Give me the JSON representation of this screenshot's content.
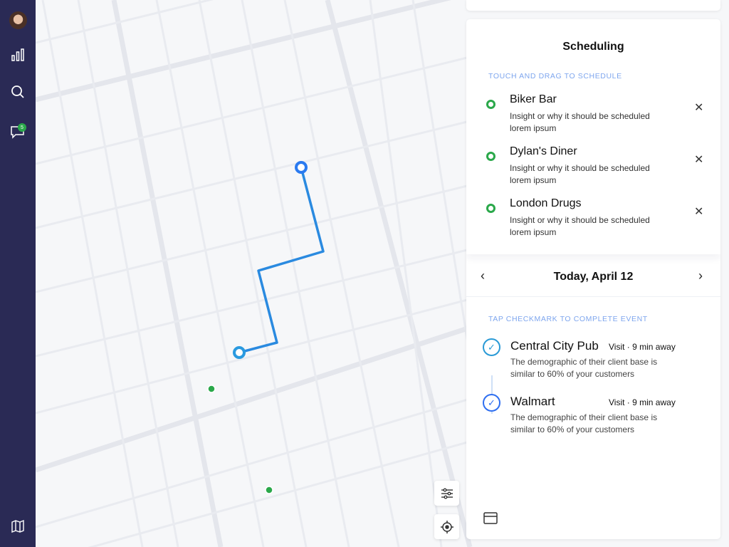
{
  "sidebar": {
    "items": [
      {
        "icon": "avatar"
      },
      {
        "icon": "bar-chart-icon"
      },
      {
        "icon": "search-icon"
      },
      {
        "icon": "chat-icon",
        "badge": "5"
      },
      {
        "icon": "map-icon"
      }
    ]
  },
  "scheduling": {
    "title": "Scheduling",
    "hint": "TOUCH AND DRAG TO SCHEDULE",
    "items": [
      {
        "name": "Biker Bar",
        "desc": "Insight or why it should be scheduled lorem ipsum"
      },
      {
        "name": "Dylan's Diner",
        "desc": "Insight or why it should be scheduled lorem ipsum"
      },
      {
        "name": "London Drugs",
        "desc": "Insight or why it should be scheduled lorem ipsum"
      }
    ]
  },
  "day": {
    "date": "Today, April 12",
    "hint": "TAP CHECKMARK TO COMPLETE EVENT",
    "events": [
      {
        "name": "Central City Pub",
        "type": "Visit",
        "distance": "9 min away",
        "desc": "The demographic of their client base is similar to 60% of your customers",
        "color": "#2a9ad6"
      },
      {
        "name": "Walmart",
        "type": "Visit",
        "distance": "9 min away",
        "desc": "The demographic of their client base is similar to 60% of your customers",
        "color": "#2f6ff0"
      }
    ]
  },
  "colors": {
    "sidebar": "#2a2a55",
    "route": "#2a8ae0",
    "pin": "#2a7af0",
    "place": "#2aa84a",
    "hint": "#7ea6ee"
  }
}
